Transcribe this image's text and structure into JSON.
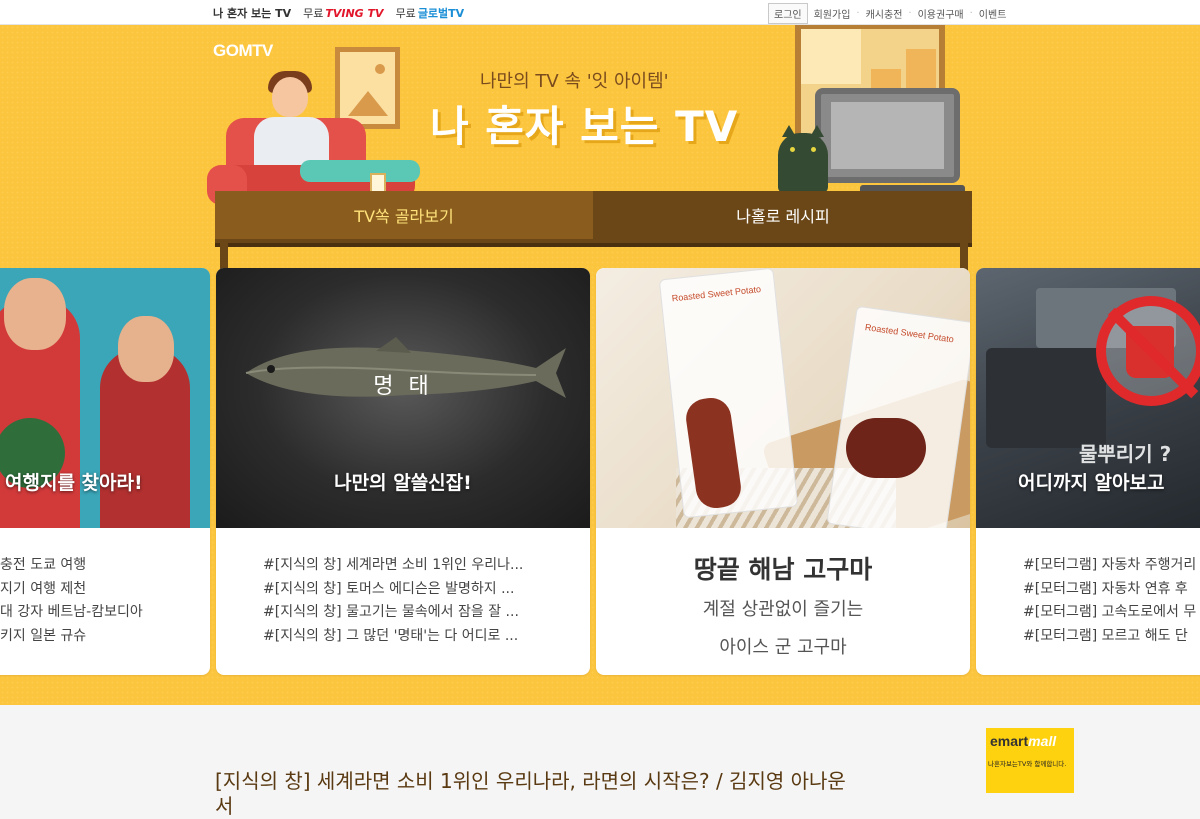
{
  "topbar": {
    "brand": "나 혼자 보는 TV",
    "links": [
      {
        "prefix": "무료",
        "label": "TVING TV"
      },
      {
        "prefix": "무료",
        "label": "글로벌TV"
      }
    ],
    "right": [
      "로그인",
      "회원가입",
      "캐시충전",
      "이용권구매",
      "이벤트"
    ]
  },
  "hero": {
    "logo": "GOMTV",
    "subtitle": "나만의 TV 속 '잇 아이템'",
    "title": "나 혼자 보는 TV",
    "tabs": [
      {
        "label": "TV쏙 골라보기",
        "active": true
      },
      {
        "label": "나홀로 레시피",
        "active": false
      }
    ]
  },
  "cards": [
    {
      "caption": "여행지를 찾아라!",
      "items": [
        "충전 도쿄 여행",
        "지기 여행 제천",
        "대 강자 베트남-캄보디아",
        "키지 일본 규슈"
      ]
    },
    {
      "image_text": "명 태",
      "caption": "나만의 알쓸신잡!",
      "items": [
        "#[지식의 창] 세계라면 소비 1위인 우리나...",
        "#[지식의 창] 토머스 에디슨은 발명하지 ...",
        "#[지식의 창] 물고기는 물속에서 잠을 잘 ...",
        "#[지식의 창] 그 많던 '명태'는 다 어디로 ..."
      ]
    },
    {
      "package_text": "Roasted Sweet Potato",
      "title": "땅끝 해남 고구마",
      "sub1": "계절 상관없이 즐기는",
      "sub2": "아이스 군 고구마"
    },
    {
      "image_text": "물뿌리기 ?",
      "caption": "어디까지 알아보고",
      "items": [
        "#[모터그램] 자동차 주행거리",
        "#[모터그램] 자동차 연휴 후",
        "#[모터그램] 고속도로에서 무",
        "#[모터그램] 모르고 해도 단"
      ]
    }
  ],
  "article": {
    "line1": "[지식의 창] 세계라면 소비 1위인 우리나라, 라면의 시작은? / 김지영 아나운",
    "line2": "서"
  },
  "ad": {
    "logo": "emart",
    "logo_accent": "mall",
    "slogan": "나혼자보는TV와 함께합니다."
  },
  "colors": {
    "hero_bg": "#fcc53e",
    "tab_active": "#8a5d1f",
    "tab_panel": "#6b4717",
    "tving_red": "#e2162b"
  }
}
